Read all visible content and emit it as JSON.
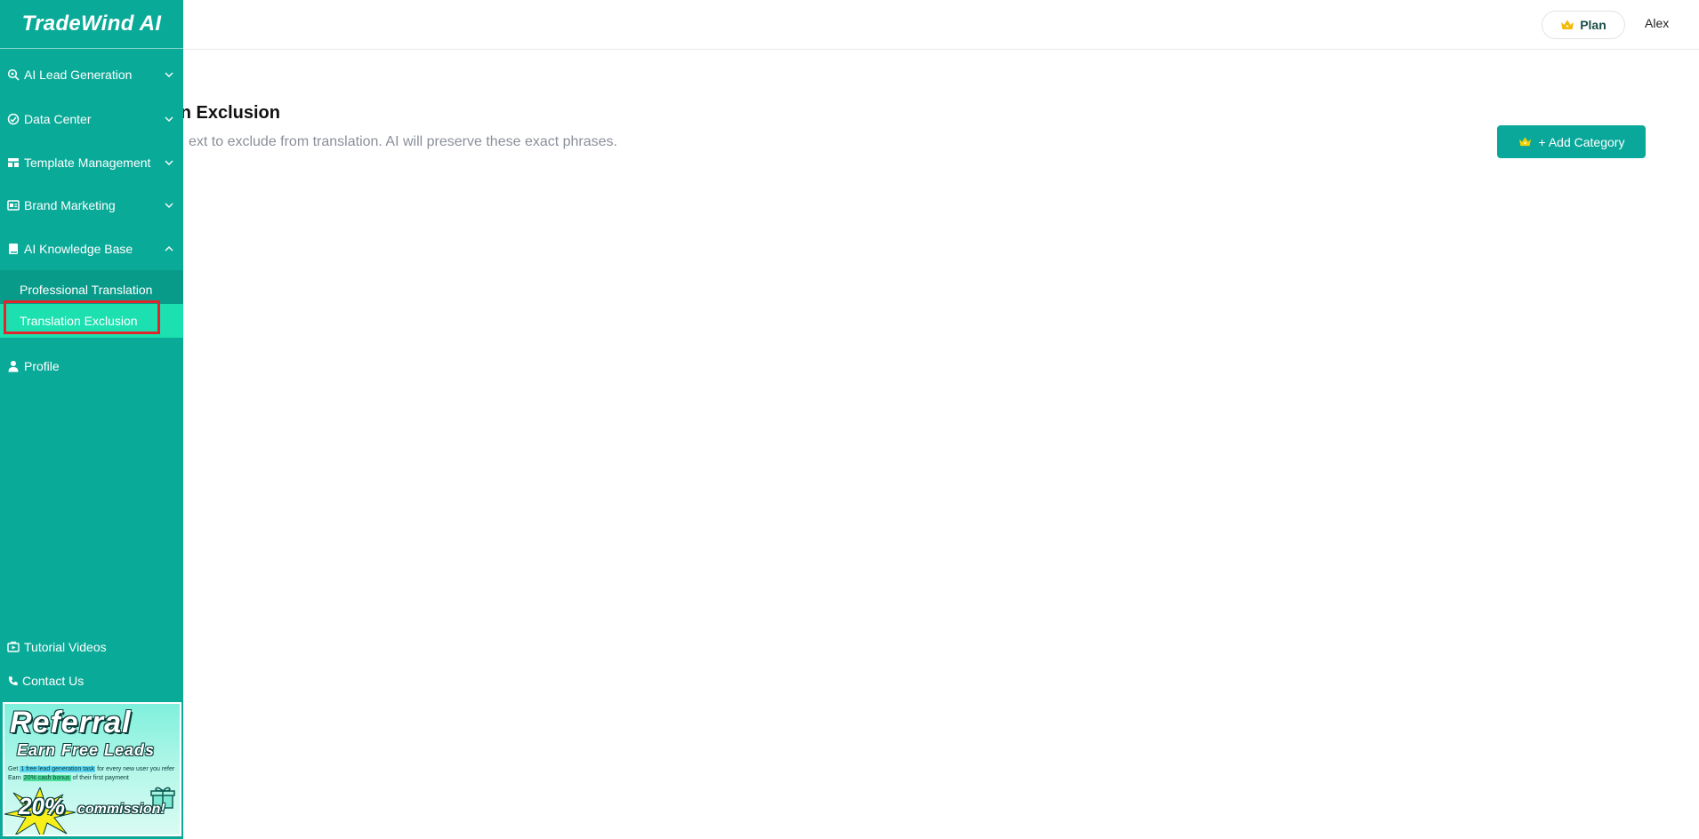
{
  "sidebar": {
    "logo": "TradeWind AI",
    "items": [
      {
        "label": "AI Lead Generation",
        "icon": "lead-search-icon",
        "expanded": false
      },
      {
        "label": "Data Center",
        "icon": "data-center-icon",
        "expanded": false
      },
      {
        "label": "Template Management",
        "icon": "template-icon",
        "expanded": false
      },
      {
        "label": "Brand Marketing",
        "icon": "brand-marketing-icon",
        "expanded": false
      },
      {
        "label": "AI Knowledge Base",
        "icon": "book-icon",
        "expanded": true
      }
    ],
    "submenu": [
      {
        "label": "Professional Translation",
        "active": false
      },
      {
        "label": "Translation Exclusion",
        "active": true
      }
    ],
    "profile": {
      "label": "Profile",
      "icon": "user-icon"
    },
    "bottom": [
      {
        "label": "Tutorial Videos",
        "icon": "video-icon"
      },
      {
        "label": "Contact Us",
        "icon": "phone-icon"
      }
    ],
    "banner": {
      "title": "Referral",
      "subtitle": "Earn Free Leads",
      "line1_pre": "Get ",
      "line1_hl": "1 free lead generation task",
      "line1_post": " for every new user you refer",
      "line2_pre": "Earn ",
      "line2_hl": "20% cash bonus",
      "line2_post": " of their first payment",
      "commission_pct": "20%",
      "commission_text": "commission!"
    }
  },
  "header": {
    "plan_label": "Plan",
    "user": "Alex"
  },
  "main": {
    "title": "on Exclusion",
    "subtitle": "ext to exclude from translation. AI will preserve these exact phrases.",
    "add_button": "+ Add Category"
  },
  "colors": {
    "sidebar": "#0aaa98",
    "submenu_bg": "#089b8a",
    "active_item": "#1de0b0",
    "primary_button": "#0aa89a",
    "highlight_border": "#e0252b",
    "crown": "#f5b800"
  }
}
